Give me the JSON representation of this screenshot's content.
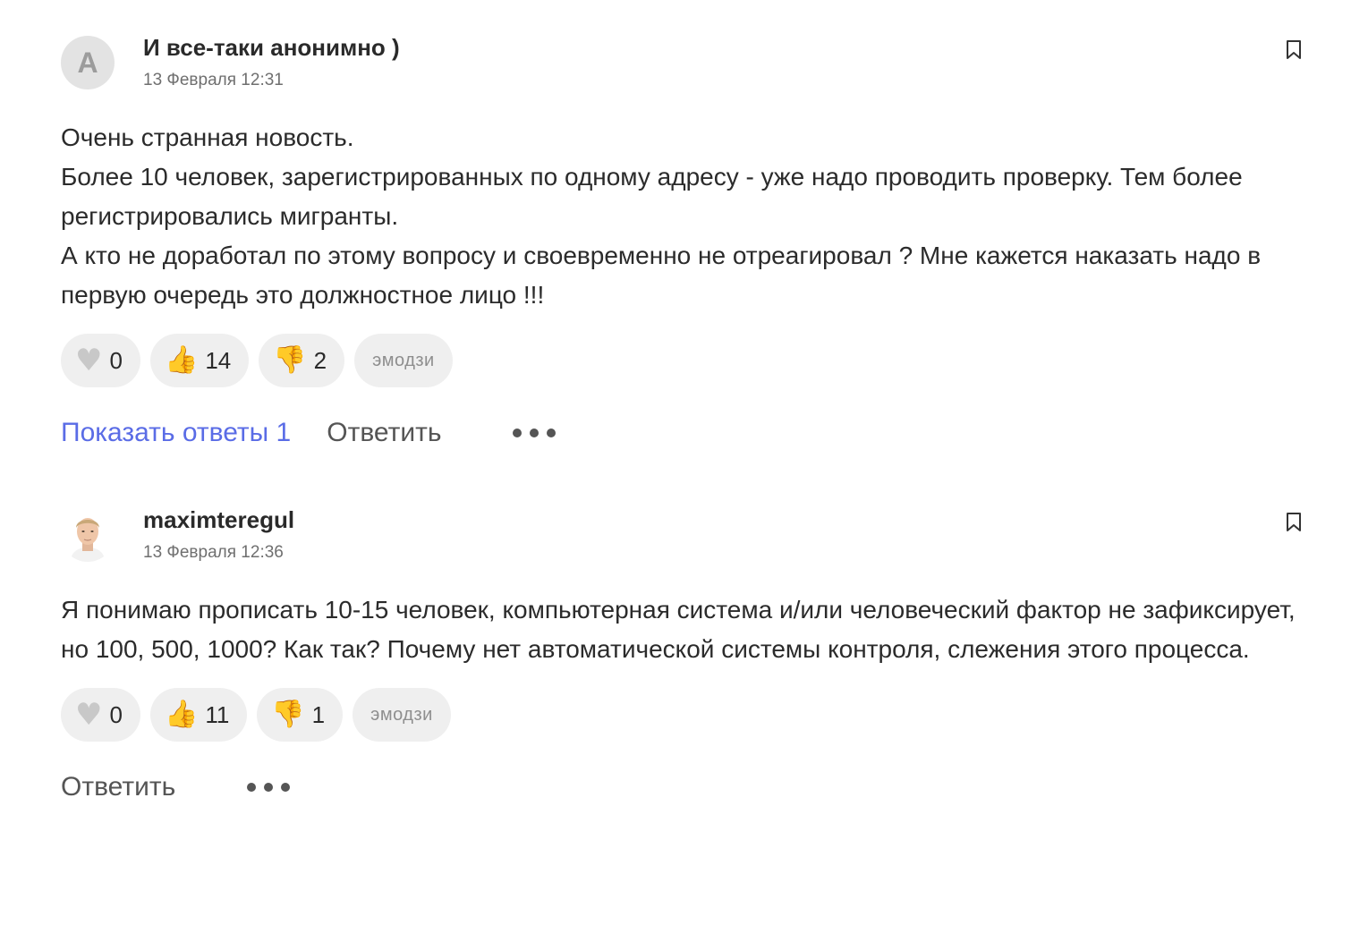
{
  "comments": [
    {
      "avatar_letter": "A",
      "author": "И все-таки анонимно )",
      "date": "13 Февраля 12:31",
      "paragraphs": [
        "Очень странная новость.",
        "Более 10 человек, зарегистрированных по одному адресу - уже надо проводить проверку. Тем более регистрировались мигранты.",
        "А кто не доработал по этому вопросу и своевременно не отреагировал ? Мне кажется наказать надо в первую очередь это должностное лицо !!!"
      ],
      "reactions": {
        "heart": "0",
        "like": "14",
        "dislike": "2",
        "emoji_label": "эмодзи"
      },
      "show_replies": "Показать ответы 1",
      "reply": "Ответить"
    },
    {
      "author": "maximteregul",
      "date": "13 Февраля 12:36",
      "paragraphs": [
        "Я понимаю прописать 10-15 человек, компьютерная система и/или человеческий фактор не зафиксирует, но 100, 500, 1000? Как так? Почему нет автоматической системы контроля, слежения этого процесса."
      ],
      "reactions": {
        "heart": "0",
        "like": "11",
        "dislike": "1",
        "emoji_label": "эмодзи"
      },
      "reply": "Ответить"
    }
  ],
  "icons": {
    "bookmark": "bookmark-icon",
    "heart": "heart-icon",
    "like": "thumbs-up-icon",
    "dislike": "thumbs-down-icon",
    "more": "more-dots-icon"
  },
  "colors": {
    "link_blue": "#5a6ce6",
    "reaction_bg": "#efefef",
    "muted_text": "#6f6f6f"
  }
}
